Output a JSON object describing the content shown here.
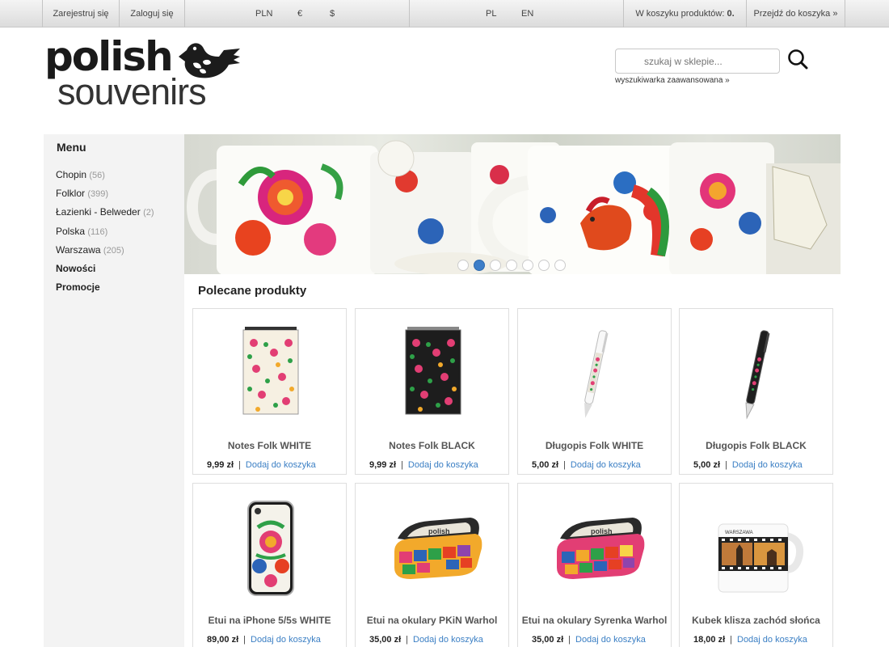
{
  "topbar": {
    "register": "Zarejestruj się",
    "login": "Zaloguj się",
    "currencies": [
      "PLN",
      "€",
      "$"
    ],
    "languages": [
      "PL",
      "EN"
    ],
    "cart_label": "W koszyku produktów:",
    "cart_count": "0.",
    "go_to_cart": "Przejdź do koszyka »"
  },
  "header": {
    "logo_top": "polish",
    "logo_bottom": "souvenirs",
    "search_placeholder": "szukaj w sklepie...",
    "advanced_search": "wyszukiwarka zaawansowana »"
  },
  "sidebar": {
    "title": "Menu",
    "items": [
      {
        "label": "Chopin",
        "count": "(56)"
      },
      {
        "label": "Folklor",
        "count": "(399)"
      },
      {
        "label": "Łazienki - Belweder",
        "count": "(2)"
      },
      {
        "label": "Polska",
        "count": "(116)"
      },
      {
        "label": "Warszawa",
        "count": "(205)"
      },
      {
        "label": "Nowości",
        "count": ""
      },
      {
        "label": "Promocje",
        "count": ""
      }
    ]
  },
  "banner": {
    "slide_count": 7,
    "active_slide": 2
  },
  "featured": {
    "title": "Polecane produkty",
    "add_label": "Dodaj do koszyka",
    "products": [
      {
        "name": "Notes Folk WHITE",
        "price": "9,99 zł",
        "thumb": "notebook-white"
      },
      {
        "name": "Notes Folk BLACK",
        "price": "9,99 zł",
        "thumb": "notebook-black"
      },
      {
        "name": "Długopis Folk WHITE",
        "price": "5,00 zł",
        "thumb": "pen-white"
      },
      {
        "name": "Długopis Folk BLACK",
        "price": "5,00 zł",
        "thumb": "pen-black"
      },
      {
        "name": "Etui na iPhone 5/5s WHITE",
        "price": "89,00 zł",
        "thumb": "phone-case"
      },
      {
        "name": "Etui na okulary PKiN Warhol",
        "price": "35,00 zł",
        "thumb": "glasses-case"
      },
      {
        "name": "Etui na okulary Syrenka Warhol",
        "price": "35,00 zł",
        "thumb": "glasses-case"
      },
      {
        "name": "Kubek klisza zachód słońca",
        "price": "18,00 zł",
        "thumb": "mug"
      }
    ]
  },
  "colors": {
    "link": "#3b7fc4",
    "active_dot": "#3d7ec8",
    "sidebar_bg": "#f3f3f3"
  }
}
